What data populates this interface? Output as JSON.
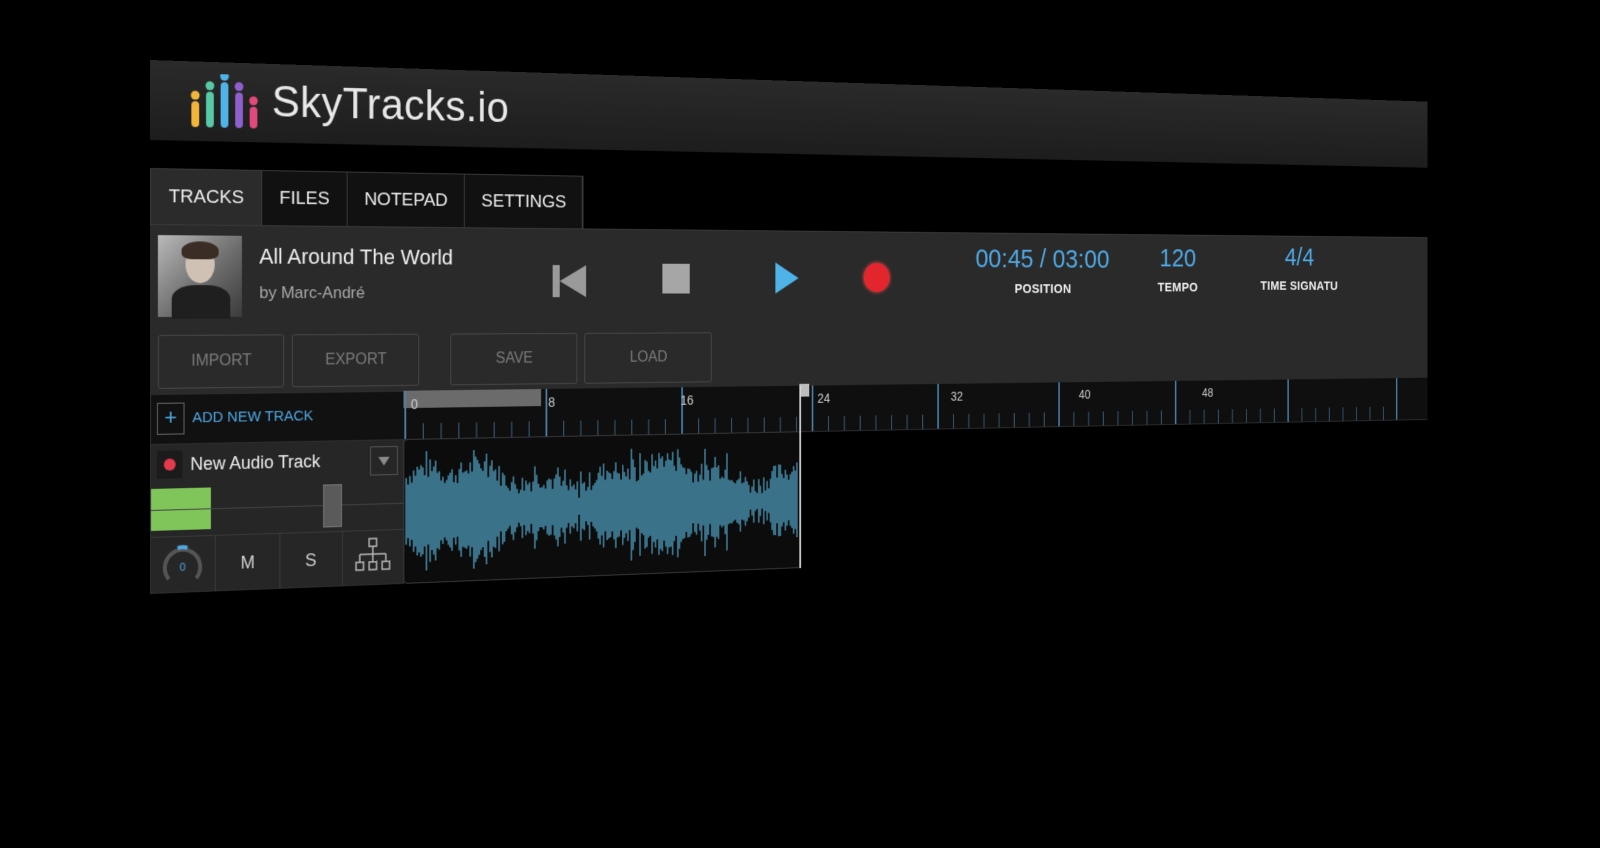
{
  "app": {
    "brand": "SkyTracks.io",
    "logo_colors": [
      "#f0b53a",
      "#57c9a6",
      "#4fb3e8",
      "#8f5fd0",
      "#e04a7a"
    ]
  },
  "tabs": [
    {
      "label": "TRACKS",
      "active": true
    },
    {
      "label": "FILES",
      "active": false
    },
    {
      "label": "NOTEPAD",
      "active": false
    },
    {
      "label": "SETTINGS",
      "active": false
    }
  ],
  "song": {
    "title": "All Around The World",
    "artist": "by Marc-André"
  },
  "transport": {
    "position_value": "00:45 / 03:00",
    "position_label": "POSITION",
    "tempo_value": "120",
    "tempo_label": "TEMPO",
    "time_sig_value": "4/4",
    "time_sig_label": "TIME SIGNATU",
    "accent": "#4fa9e5",
    "record_color": "#e3262e"
  },
  "actions": {
    "import": "IMPORT",
    "export": "EXPORT",
    "save": "SAVE",
    "load": "LOAD"
  },
  "tracks_panel": {
    "add_label": "ADD NEW TRACK",
    "ruler_marks": [
      "0",
      "8",
      "16",
      "24",
      "32",
      "40",
      "48"
    ]
  },
  "track": {
    "name": "New Audio Track",
    "pan_value": "0",
    "mute": "M",
    "solo": "S",
    "waveform_color": "#4f9fc0",
    "meter_level": 0.23
  }
}
